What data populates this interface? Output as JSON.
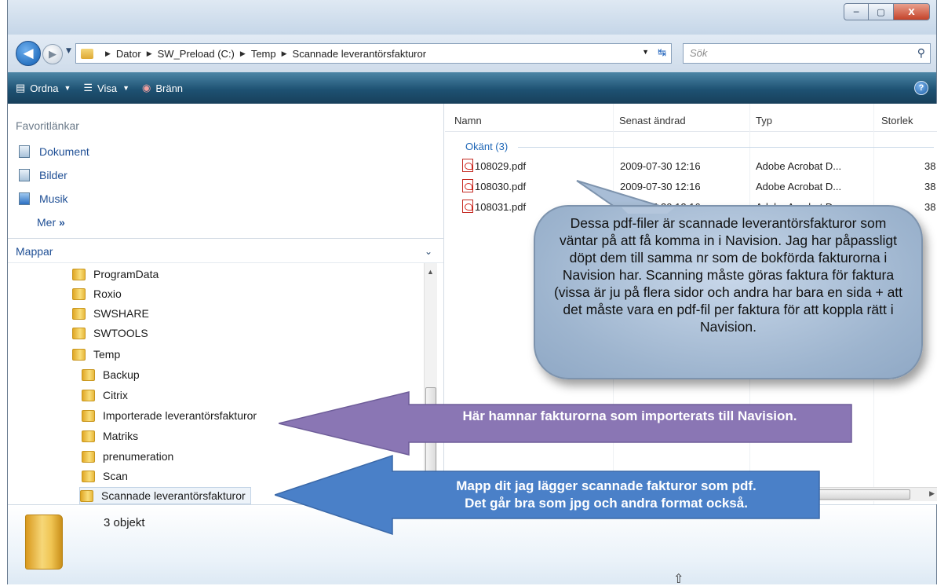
{
  "window": {
    "controls": {
      "minimize": "─",
      "maximize": "▢",
      "close": "X"
    }
  },
  "address": {
    "breadcrumb": [
      "Dator",
      "SW_Preload (C:)",
      "Temp",
      "Scannade leverantörsfakturor"
    ],
    "search_placeholder": "Sök",
    "icons": {
      "back": "back-arrow-icon",
      "forward": "forward-arrow-icon",
      "refresh": "refresh-icon",
      "search": "search-icon"
    }
  },
  "toolbar": {
    "organize": "Ordna",
    "view": "Visa",
    "burn": "Bränn",
    "help": "?"
  },
  "favorites": {
    "title": "Favoritlänkar",
    "items": [
      "Dokument",
      "Bilder",
      "Musik"
    ],
    "more": "Mer",
    "more_arrow": "»"
  },
  "folders": {
    "title": "Mappar",
    "items": [
      "ProgramData",
      "Roxio",
      "SWSHARE",
      "SWTOOLS",
      "Temp",
      "Backup",
      "Citrix",
      "Importerade leverantörsfakturor",
      "Matriks",
      "prenumeration",
      "Scan",
      "Scannade leverantörsfakturor"
    ],
    "selected": "Scannade leverantörsfakturor"
  },
  "file_list": {
    "columns": [
      "Namn",
      "Senast ändrad",
      "Typ",
      "Storlek"
    ],
    "group": "Okänt (3)",
    "files": [
      {
        "name": "108029.pdf",
        "date": "2009-07-30 12:16",
        "type": "Adobe Acrobat D...",
        "size": "38"
      },
      {
        "name": "108030.pdf",
        "date": "2009-07-30 12:16",
        "type": "Adobe Acrobat D...",
        "size": "38"
      },
      {
        "name": "108031.pdf",
        "date": "2009-07-30 12:16",
        "type": "Adobe Acrobat D...",
        "size": "38"
      }
    ]
  },
  "details": {
    "count": "3 objekt"
  },
  "annotations": {
    "callout": "Dessa pdf-filer är scannade leverantörsfakturor som väntar på att få komma in i Navision. Jag har påpassligt döpt dem till samma nr som de bokförda fakturorna i Navision har. Scanning måste göras faktura för faktura (vissa är ju på flera sidor och andra har bara en sida + att det måste vara en pdf-fil per faktura för att koppla rätt i Navision.",
    "purple_arrow": "Här hamnar fakturorna som importerats till Navision.",
    "blue_arrow_line1": "Mapp dit jag lägger scannade fakturor som pdf.",
    "blue_arrow_line2": "Det går bra som jpg och andra format också.",
    "colors": {
      "purple": "#8a76b4",
      "blue": "#4a80c8",
      "callout": "#b3c6dc"
    }
  }
}
